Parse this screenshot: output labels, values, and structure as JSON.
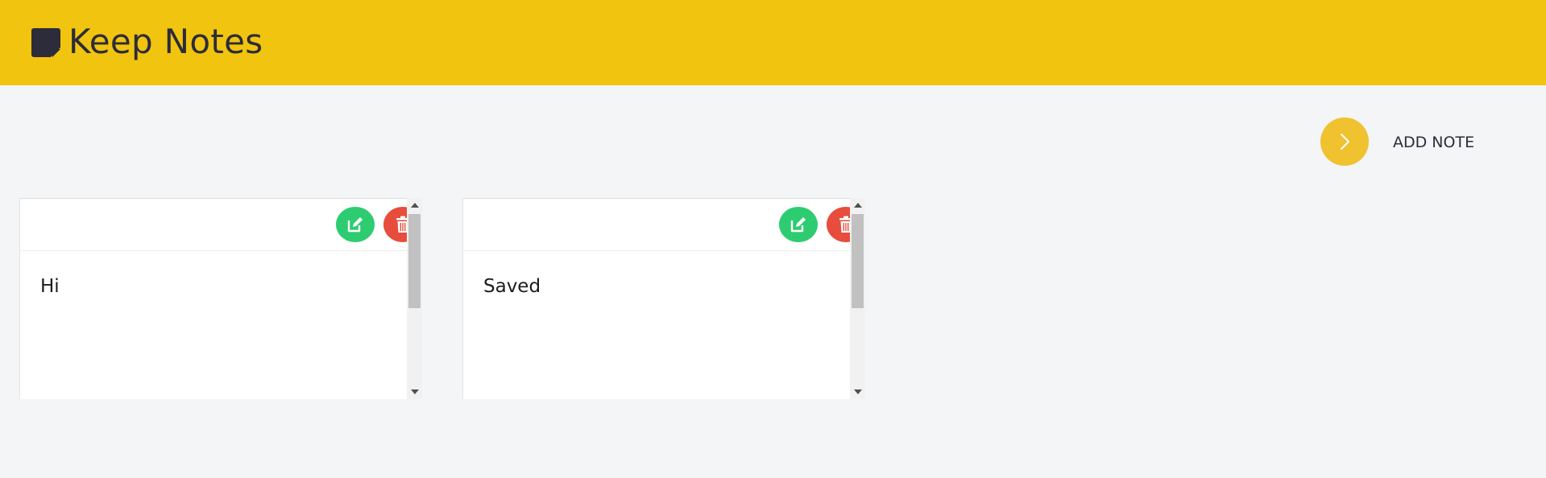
{
  "header": {
    "title": "Keep Notes",
    "background": "#f1c40f",
    "logo_icon": "sticky-note-icon"
  },
  "actions": {
    "add_note_label": "ADD NOTE",
    "add_note_icon": "chevron-right-icon",
    "accent": "#f0c230"
  },
  "notes": [
    {
      "text": "Hi",
      "edit_icon": "edit-icon",
      "delete_icon": "trash-icon"
    },
    {
      "text": "Saved",
      "edit_icon": "edit-icon",
      "delete_icon": "trash-icon"
    }
  ],
  "colors": {
    "edit": "#2ecc71",
    "delete": "#e74c3c",
    "page_background": "#f3f5f6"
  }
}
